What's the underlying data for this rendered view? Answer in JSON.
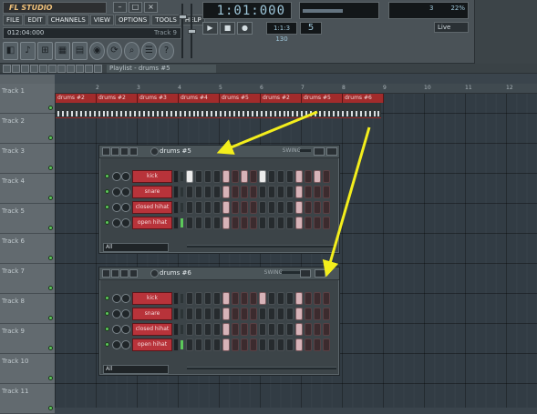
{
  "app": {
    "logo": "FL STUDIO",
    "winbtns": [
      "–",
      "□",
      "×"
    ],
    "menu": [
      "FILE",
      "EDIT",
      "CHANNELS",
      "VIEW",
      "OPTIONS",
      "TOOLS",
      "HELP"
    ],
    "hint": "012:04:000",
    "hint_right": "Track 9"
  },
  "transport": {
    "time": "1:01:000",
    "time_label": "",
    "scope_label": "",
    "buttons": [
      "▶",
      "■",
      "●",
      "⊞"
    ],
    "tempo": "1:1:3 130",
    "pattern": "5",
    "cpu_a": "3",
    "cpu_b": "22%",
    "cpu_c": "",
    "cpu_d": "",
    "mode": "Live"
  },
  "toolbar": [
    "◧",
    "♪",
    "⊞",
    "▦",
    "▤",
    "◉",
    "⟳",
    "⌕",
    "☰",
    "?"
  ],
  "playlist": {
    "title": "Playlist - drums #5",
    "ruler": [
      "2",
      "3",
      "4",
      "5",
      "6",
      "7",
      "8",
      "9",
      "10",
      "11",
      "12"
    ],
    "clips": [
      "drums #2",
      "drums #2",
      "drums #3",
      "drums #4",
      "drums #5",
      "drums #2",
      "drums #5",
      "drums #6"
    ],
    "tracks": [
      "Track 1",
      "Track 2",
      "Track 3",
      "Track 4",
      "Track 5",
      "Track 6",
      "Track 7",
      "Track 8",
      "Track 9",
      "Track 10",
      "Track 11"
    ]
  },
  "step5": {
    "title": "drums #5",
    "swing": "SWING",
    "filter": "All",
    "rows": [
      {
        "name": "kick",
        "ind": false,
        "steps": "odddrdrdoddd rdrd"
      },
      {
        "name": "snare",
        "ind": false,
        "steps": "ddddrdddddddrddd"
      },
      {
        "name": "closed hihat",
        "ind": false,
        "steps": "ddddrdddddddrddd"
      },
      {
        "name": "open hihat",
        "ind": true,
        "steps": "ddddrdddddddrddd"
      }
    ]
  },
  "step6": {
    "title": "drums #6",
    "swing": "SWING",
    "filter": "All",
    "rows": [
      {
        "name": "kick",
        "ind": false,
        "steps": "ddddrdddrdddrddd"
      },
      {
        "name": "snare",
        "ind": false,
        "steps": "ddddrdddddddrddd"
      },
      {
        "name": "closed hihat",
        "ind": false,
        "steps": "ddddrdddddddrddd"
      },
      {
        "name": "open hihat",
        "ind": true,
        "steps": "ddddrdddddddrddd"
      }
    ]
  },
  "colors": {
    "clip": "#a22b2b",
    "arrow": "#f3ee1c",
    "led": "#5cc85a"
  }
}
